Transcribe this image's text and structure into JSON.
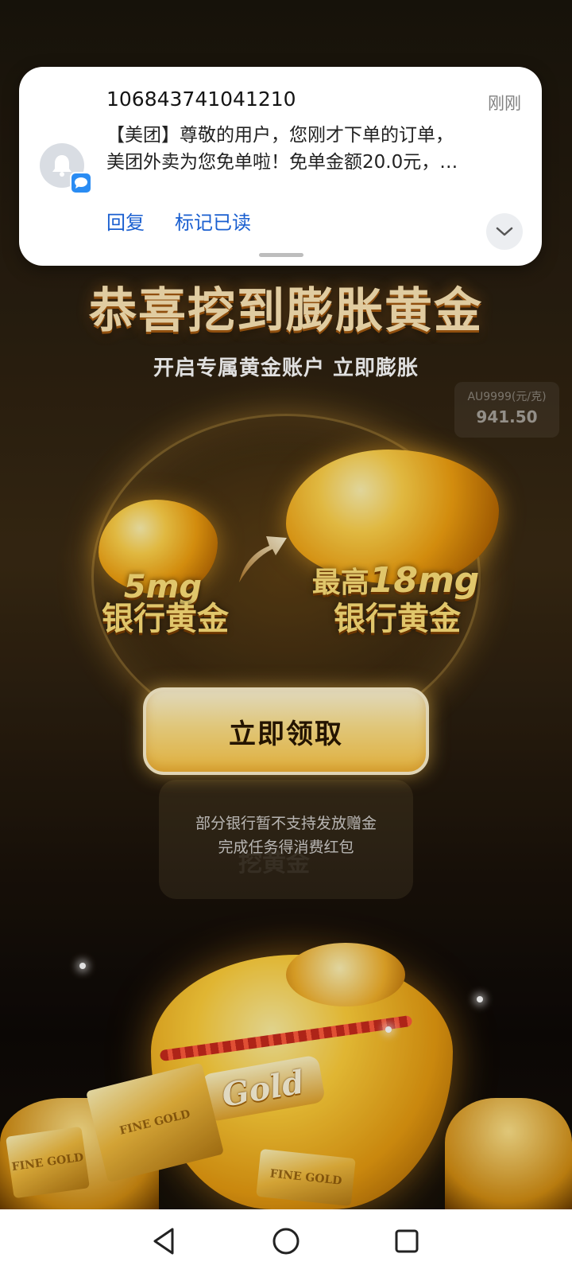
{
  "notification": {
    "sender": "106843741041210",
    "time": "刚刚",
    "line1": "【美团】尊敬的用户，您刚才下单的订单，",
    "line2": "美团外卖为您免单啦！免单金额20.0元，…",
    "reply_label": "回复",
    "mark_read_label": "标记已读",
    "avatar_icon": "bell-icon",
    "badge_icon": "message-icon",
    "expand_icon": "chevron-down-icon"
  },
  "headline": {
    "title": "恭喜挖到膨胀黄金",
    "subtitle": "开启专属黄金账户  立即膨胀"
  },
  "price_chip": {
    "label": "AU9999(元/克)",
    "value": "941.50"
  },
  "offer": {
    "small_amount": "5mg",
    "small_label": "银行黄金",
    "big_prefix": "最高",
    "big_amount": "18mg",
    "big_label": "银行黄金",
    "arrow_icon": "arrow-up-right-icon"
  },
  "claim_button": {
    "label": "立即领取"
  },
  "notice": {
    "line1": "部分银行暂不支持发放赠金",
    "line2": "完成任务得消费红包"
  },
  "background": {
    "card_text": "挖黄金",
    "tag_text": "Gold",
    "bar_text": "FINE GOLD"
  },
  "nav": {
    "back_icon": "back-triangle-icon",
    "home_icon": "home-circle-icon",
    "recent_icon": "recent-square-icon"
  },
  "colors": {
    "accent_gold": "#ffc845",
    "link_blue": "#1a5fd0",
    "badge_blue": "#2a8cf3"
  }
}
